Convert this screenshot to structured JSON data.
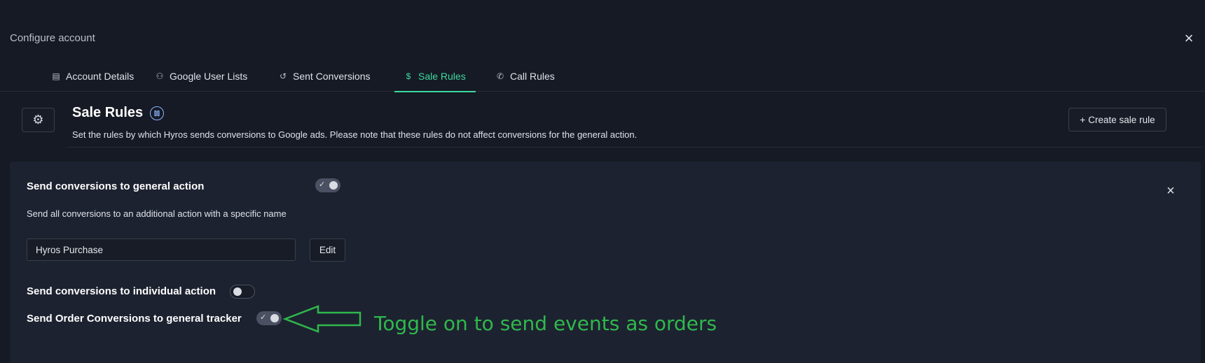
{
  "modal": {
    "title": "Configure account",
    "close_symbol": "×"
  },
  "tabs": [
    {
      "label": "Account Details",
      "icon": "document-icon",
      "icon_char": "▤",
      "active": false
    },
    {
      "label": "Google User Lists",
      "icon": "users-icon",
      "icon_char": "⚇",
      "active": false
    },
    {
      "label": "Sent Conversions",
      "icon": "history-icon",
      "icon_char": "↺",
      "active": false
    },
    {
      "label": "Sale Rules",
      "icon": "dollar-icon",
      "icon_char": "$",
      "active": true
    },
    {
      "label": "Call Rules",
      "icon": "phone-icon",
      "icon_char": "✆",
      "active": false
    }
  ],
  "section": {
    "title": "Sale Rules",
    "description": "Set the rules by which Hyros sends conversions to Google ads. Please note that these rules do not affect conversions for the general action.",
    "gear_symbol": "⚙",
    "create_button": {
      "icon": "+",
      "label": "Create sale rule"
    }
  },
  "rules": {
    "general_action": {
      "label": "Send conversions to general action",
      "enabled": true,
      "description": "Send all conversions to an additional action with a specific name",
      "input_value": "Hyros Purchase",
      "edit_label": "Edit"
    },
    "individual_action": {
      "label": "Send conversions to individual action",
      "enabled": false
    },
    "order_tracker": {
      "label": "Send Order Conversions to general tracker",
      "enabled": true
    }
  },
  "annotation": {
    "text": "Toggle on to send events as orders",
    "color": "#2fb84c"
  },
  "colors": {
    "accent": "#3fd9a0",
    "background": "#151a24",
    "panel": "#1d2230"
  }
}
